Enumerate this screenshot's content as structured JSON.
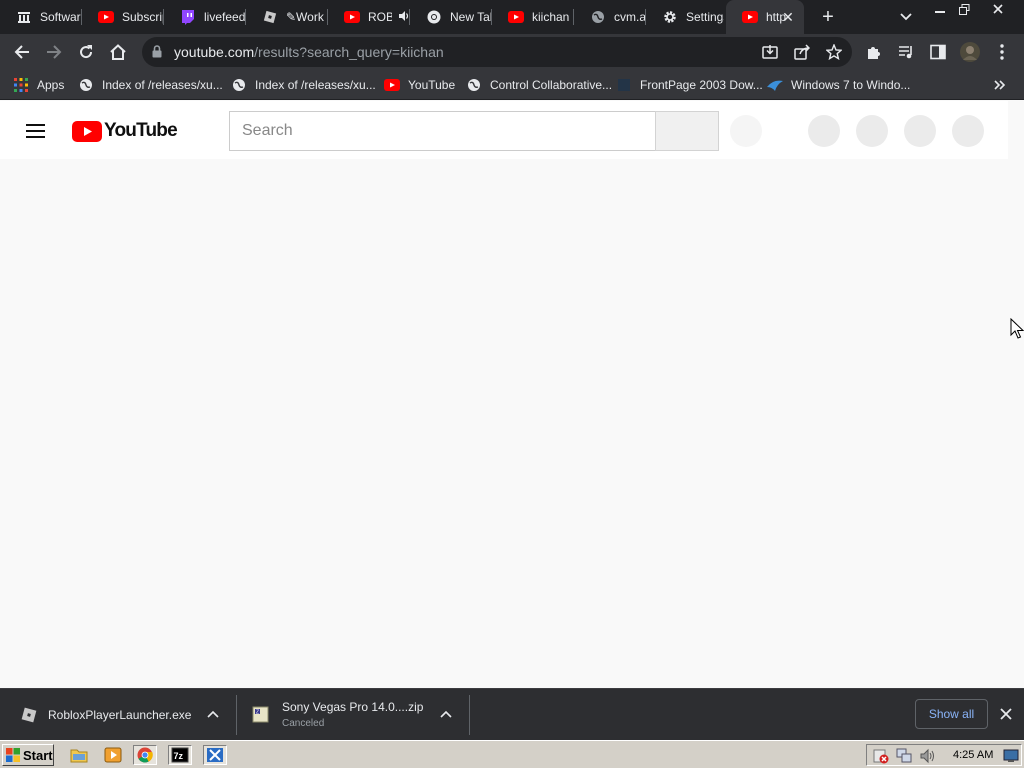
{
  "browser": {
    "tabs": [
      {
        "title": "Software",
        "icon": "library-icon"
      },
      {
        "title": "Subscriptions",
        "icon": "youtube-icon"
      },
      {
        "title": "livefeed",
        "icon": "twitch-icon"
      },
      {
        "title": "✎Work",
        "icon": "roblox-icon"
      },
      {
        "title": "ROB",
        "icon": "youtube-icon",
        "audio": true
      },
      {
        "title": "New Tab",
        "icon": "chrome-icon"
      },
      {
        "title": "kiichan",
        "icon": "youtube-icon"
      },
      {
        "title": "cvm.am",
        "icon": "globe-icon"
      },
      {
        "title": "Settings",
        "icon": "gear-icon"
      },
      {
        "title": "http",
        "icon": "youtube-icon",
        "active": true
      }
    ],
    "address": {
      "host": "youtube.com",
      "path": "/results?search_query=kiichan"
    },
    "bookmarks": [
      {
        "label": "Apps",
        "icon": "apps-grid-icon"
      },
      {
        "label": "Index of /releases/xu...",
        "icon": "globe-icon"
      },
      {
        "label": "Index of /releases/xu...",
        "icon": "globe-icon"
      },
      {
        "label": "YouTube",
        "icon": "youtube-icon"
      },
      {
        "label": "Control Collaborative...",
        "icon": "globe-icon"
      },
      {
        "label": "FrontPage 2003 Dow...",
        "icon": "frontpage-icon"
      },
      {
        "label": "Windows 7 to Windo...",
        "icon": "site-icon"
      }
    ]
  },
  "youtube": {
    "logo_text": "YouTube",
    "search_placeholder": "Search"
  },
  "downloads": {
    "items": [
      {
        "name": "RobloxPlayerLauncher.exe",
        "status": ""
      },
      {
        "name": "Sony Vegas Pro 14.0....zip",
        "status": "Canceled"
      }
    ],
    "show_all_label": "Show all"
  },
  "taskbar": {
    "start_label": "Start",
    "quick_launch": [
      "explorer-icon",
      "media-player-icon",
      "chrome-icon",
      "7zip-icon",
      "app-icon"
    ],
    "clock": "4:25 AM"
  },
  "colors": {
    "youtube_red": "#ff0000",
    "link_blue": "#8ab4f8",
    "tab_bg": "#202124",
    "toolbar_bg": "#35363a"
  }
}
